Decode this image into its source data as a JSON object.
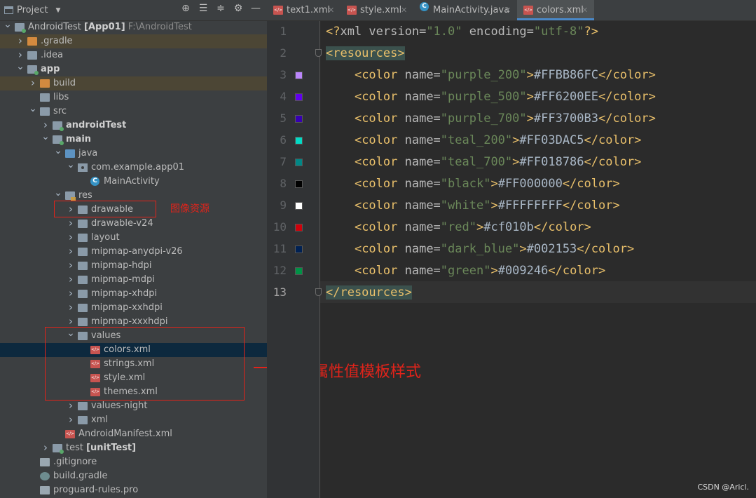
{
  "project_panel": {
    "title": "Project",
    "tree": [
      {
        "label": "AndroidTest [App01]",
        "suffix": "F:\\AndroidTest",
        "icon": "module-folder-icon",
        "depth": 0,
        "expanded": true
      },
      {
        "label": ".gradle",
        "icon": "folder-orange-icon",
        "depth": 1,
        "expanded": false
      },
      {
        "label": ".idea",
        "icon": "folder-grey-icon",
        "depth": 1,
        "expanded": false
      },
      {
        "label": "app",
        "icon": "module-folder-icon",
        "depth": 1,
        "expanded": true
      },
      {
        "label": "build",
        "icon": "folder-orange-icon",
        "depth": 2,
        "expanded": false
      },
      {
        "label": "libs",
        "icon": "folder-grey-icon",
        "depth": 2
      },
      {
        "label": "src",
        "icon": "folder-grey-icon",
        "depth": 2,
        "expanded": true
      },
      {
        "label": "androidTest",
        "icon": "module-folder-icon",
        "depth": 3,
        "expanded": false
      },
      {
        "label": "main",
        "icon": "module-folder-icon",
        "depth": 3,
        "expanded": true
      },
      {
        "label": "java",
        "icon": "source-folder-icon",
        "depth": 4,
        "expanded": true
      },
      {
        "label": "com.example.app01",
        "icon": "package-icon",
        "depth": 5,
        "expanded": true
      },
      {
        "label": "MainActivity",
        "icon": "class-icon",
        "depth": 6
      },
      {
        "label": "res",
        "icon": "resource-folder-icon",
        "depth": 4,
        "expanded": true
      },
      {
        "label": "drawable",
        "icon": "folder-grey-icon",
        "depth": 5,
        "expanded": false
      },
      {
        "label": "drawable-v24",
        "icon": "folder-grey-icon",
        "depth": 5,
        "expanded": false
      },
      {
        "label": "layout",
        "icon": "folder-grey-icon",
        "depth": 5,
        "expanded": false
      },
      {
        "label": "mipmap-anydpi-v26",
        "icon": "folder-grey-icon",
        "depth": 5,
        "expanded": false
      },
      {
        "label": "mipmap-hdpi",
        "icon": "folder-grey-icon",
        "depth": 5,
        "expanded": false
      },
      {
        "label": "mipmap-mdpi",
        "icon": "folder-grey-icon",
        "depth": 5,
        "expanded": false
      },
      {
        "label": "mipmap-xhdpi",
        "icon": "folder-grey-icon",
        "depth": 5,
        "expanded": false
      },
      {
        "label": "mipmap-xxhdpi",
        "icon": "folder-grey-icon",
        "depth": 5,
        "expanded": false
      },
      {
        "label": "mipmap-xxxhdpi",
        "icon": "folder-grey-icon",
        "depth": 5,
        "expanded": false
      },
      {
        "label": "values",
        "icon": "folder-grey-icon",
        "depth": 5,
        "expanded": true
      },
      {
        "label": "colors.xml",
        "icon": "xml-file-icon",
        "depth": 6,
        "selected": true
      },
      {
        "label": "strings.xml",
        "icon": "xml-file-icon",
        "depth": 6
      },
      {
        "label": "style.xml",
        "icon": "xml-file-icon",
        "depth": 6
      },
      {
        "label": "themes.xml",
        "icon": "xml-file-icon",
        "depth": 6
      },
      {
        "label": "values-night",
        "icon": "folder-grey-icon",
        "depth": 5,
        "expanded": false
      },
      {
        "label": "xml",
        "icon": "folder-grey-icon",
        "depth": 5,
        "expanded": false
      },
      {
        "label": "AndroidManifest.xml",
        "icon": "manifest-file-icon",
        "depth": 4
      },
      {
        "label": "test [unitTest]",
        "icon": "module-folder-icon",
        "depth": 3,
        "expanded": false
      },
      {
        "label": ".gitignore",
        "icon": "gitignore-file-icon",
        "depth": 2
      },
      {
        "label": "build.gradle",
        "icon": "gradle-file-icon",
        "depth": 2
      },
      {
        "label": "proguard-rules.pro",
        "icon": "text-file-icon",
        "depth": 2
      }
    ]
  },
  "annotations": {
    "drawable_note": "图像资源",
    "values_note": "属性值模板样式"
  },
  "tabs": [
    {
      "label": "text1.xml",
      "icon": "xml-file-icon"
    },
    {
      "label": "style.xml",
      "icon": "xml-file-icon"
    },
    {
      "label": "MainActivity.java",
      "icon": "class-icon"
    },
    {
      "label": "colors.xml",
      "icon": "xml-file-icon",
      "active": true
    }
  ],
  "editor": {
    "line_numbers": [
      "1",
      "2",
      "3",
      "4",
      "5",
      "6",
      "7",
      "8",
      "9",
      "10",
      "11",
      "12",
      "13"
    ],
    "prolog": {
      "version": "1.0",
      "encoding": "utf-8"
    },
    "root_tag": "resources",
    "colors": [
      {
        "name": "purple_200",
        "value": "#FFBB86FC",
        "swatch": "#BB86FC"
      },
      {
        "name": "purple_500",
        "value": "#FF6200EE",
        "swatch": "#6200EE"
      },
      {
        "name": "purple_700",
        "value": "#FF3700B3",
        "swatch": "#3700B3"
      },
      {
        "name": "teal_200",
        "value": "#FF03DAC5",
        "swatch": "#03DAC5"
      },
      {
        "name": "teal_700",
        "value": "#FF018786",
        "swatch": "#018786"
      },
      {
        "name": "black",
        "value": "#FF000000",
        "swatch": "#000000"
      },
      {
        "name": "white",
        "value": "#FFFFFFFF",
        "swatch": "#FFFFFF"
      },
      {
        "name": "red",
        "value": "#cf010b",
        "swatch": "#cf010b"
      },
      {
        "name": "dark_blue",
        "value": "#002153",
        "swatch": "#002153"
      },
      {
        "name": "green",
        "value": "#009246",
        "swatch": "#009246"
      }
    ]
  },
  "watermark": "CSDN @Aricl."
}
